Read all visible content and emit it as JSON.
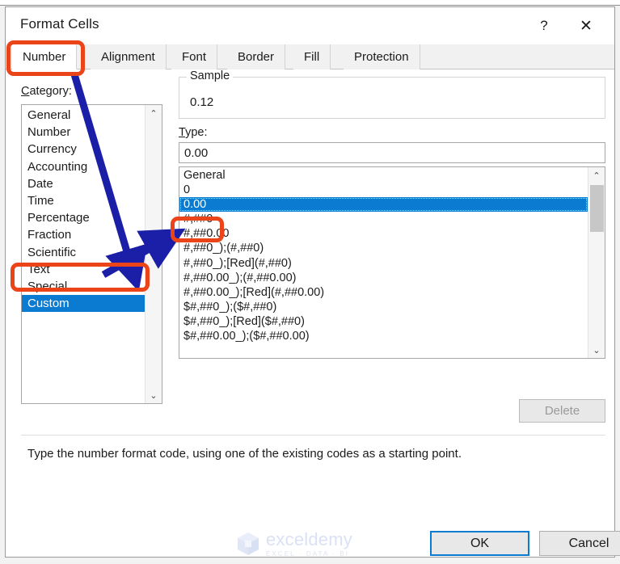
{
  "dialog": {
    "title": "Format Cells",
    "help_button": "?",
    "close_button": "✕"
  },
  "tabs": [
    {
      "label": "Number",
      "active": true
    },
    {
      "label": "Alignment",
      "active": false
    },
    {
      "label": "Font",
      "active": false
    },
    {
      "label": "Border",
      "active": false
    },
    {
      "label": "Fill",
      "active": false
    },
    {
      "label": "Protection",
      "active": false
    }
  ],
  "category": {
    "label": "Category:",
    "accelerator": "C",
    "items": [
      "General",
      "Number",
      "Currency",
      "Accounting",
      "Date",
      "Time",
      "Percentage",
      "Fraction",
      "Scientific",
      "Text",
      "Special",
      "Custom"
    ],
    "selected": "Custom",
    "selected_index": 11
  },
  "sample": {
    "legend": "Sample",
    "value": "0.12"
  },
  "type": {
    "label": "Type:",
    "accelerator": "T",
    "input_value": "0.00",
    "input_placeholder": "",
    "items": [
      "General",
      "0",
      "0.00",
      "#,##0",
      "#,##0.00",
      "#,##0_);(#,##0)",
      "#,##0_);[Red](#,##0)",
      "#,##0.00_);(#,##0.00)",
      "#,##0.00_);[Red](#,##0.00)",
      "$#,##0_);($#,##0)",
      "$#,##0_);[Red]($#,##0)",
      "$#,##0.00_);($#,##0.00)"
    ],
    "selected": "0.00",
    "selected_index": 2
  },
  "buttons": {
    "delete": "Delete",
    "delete_enabled": false,
    "ok": "OK",
    "cancel": "Cancel"
  },
  "help_text": "Type the number format code, using one of the existing codes as a starting point.",
  "watermark": {
    "name": "exceldemy",
    "tagline": "EXCEL · DATA · BI"
  },
  "scroll_icons": {
    "up": "⌃",
    "down": "⌄"
  },
  "annotation": {
    "box_color": "#ea4418",
    "arrow_color": "#1b1fa8",
    "arrows": [
      {
        "from": "number-tab",
        "to": "category-custom"
      },
      {
        "from": "category-custom",
        "to": "type-item-0.00"
      }
    ]
  }
}
